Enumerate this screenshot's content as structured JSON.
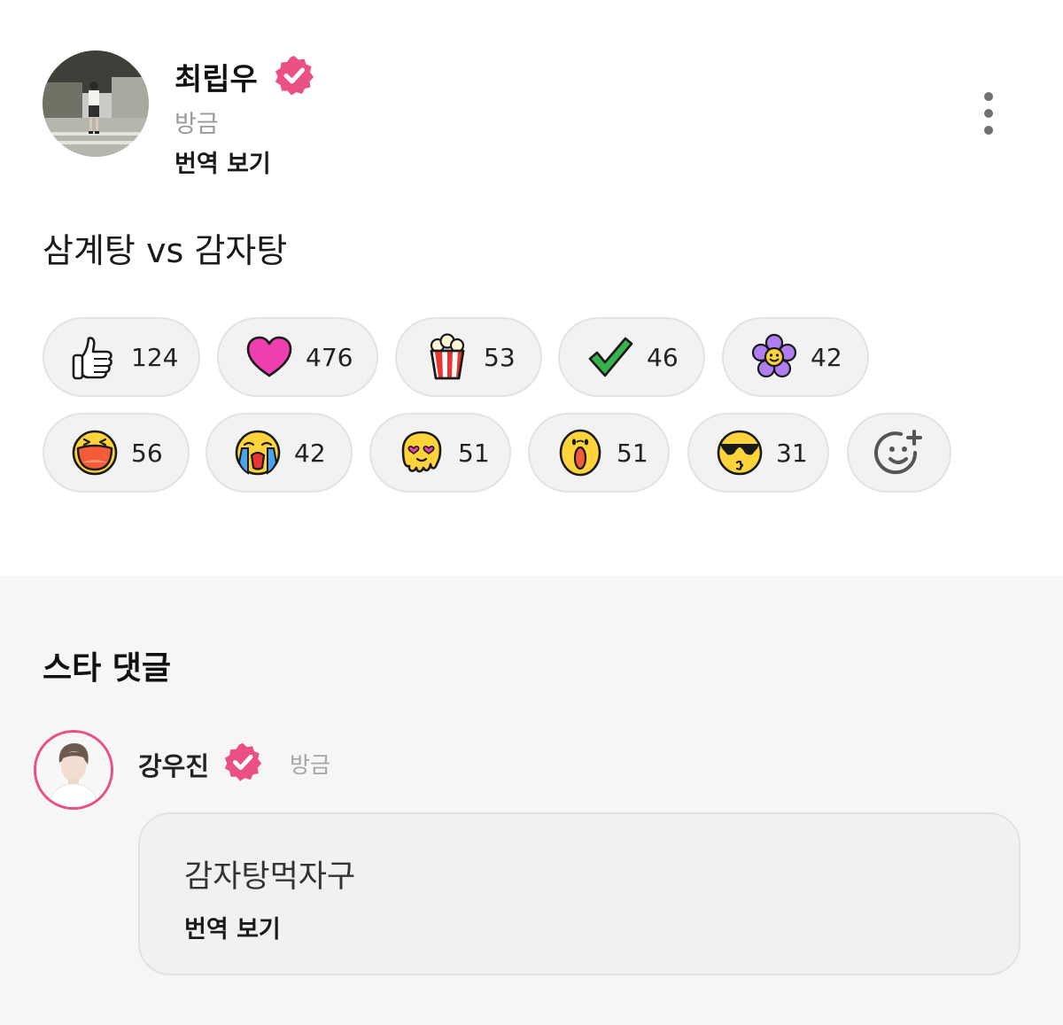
{
  "post": {
    "author": {
      "name": "최립우",
      "time": "방금",
      "verified": true
    },
    "translate_label": "번역 보기",
    "text": "삼계탕 vs 감자탕",
    "reactions": [
      {
        "icon": "thumbs-up-icon",
        "count": "124"
      },
      {
        "icon": "heart-icon",
        "count": "476"
      },
      {
        "icon": "popcorn-icon",
        "count": "53"
      },
      {
        "icon": "check-icon",
        "count": "46"
      },
      {
        "icon": "flower-icon",
        "count": "42"
      },
      {
        "icon": "laughing-face-icon",
        "count": "56"
      },
      {
        "icon": "crying-face-icon",
        "count": "42"
      },
      {
        "icon": "melting-heart-eyes-icon",
        "count": "51"
      },
      {
        "icon": "surprised-face-icon",
        "count": "51"
      },
      {
        "icon": "sunglasses-face-icon",
        "count": "31"
      }
    ],
    "add_reaction_icon": "add-reaction-icon",
    "more_icon": "more-vertical-icon"
  },
  "star_comments": {
    "title": "스타 댓글",
    "comment": {
      "author": "강우진",
      "time": "방금",
      "verified": true,
      "text": "감자탕먹자구",
      "translate_label": "번역 보기"
    }
  },
  "colors": {
    "accent": "#ea4f86",
    "chip_bg": "#f2f2f2",
    "section_bg": "#f6f6f6"
  }
}
